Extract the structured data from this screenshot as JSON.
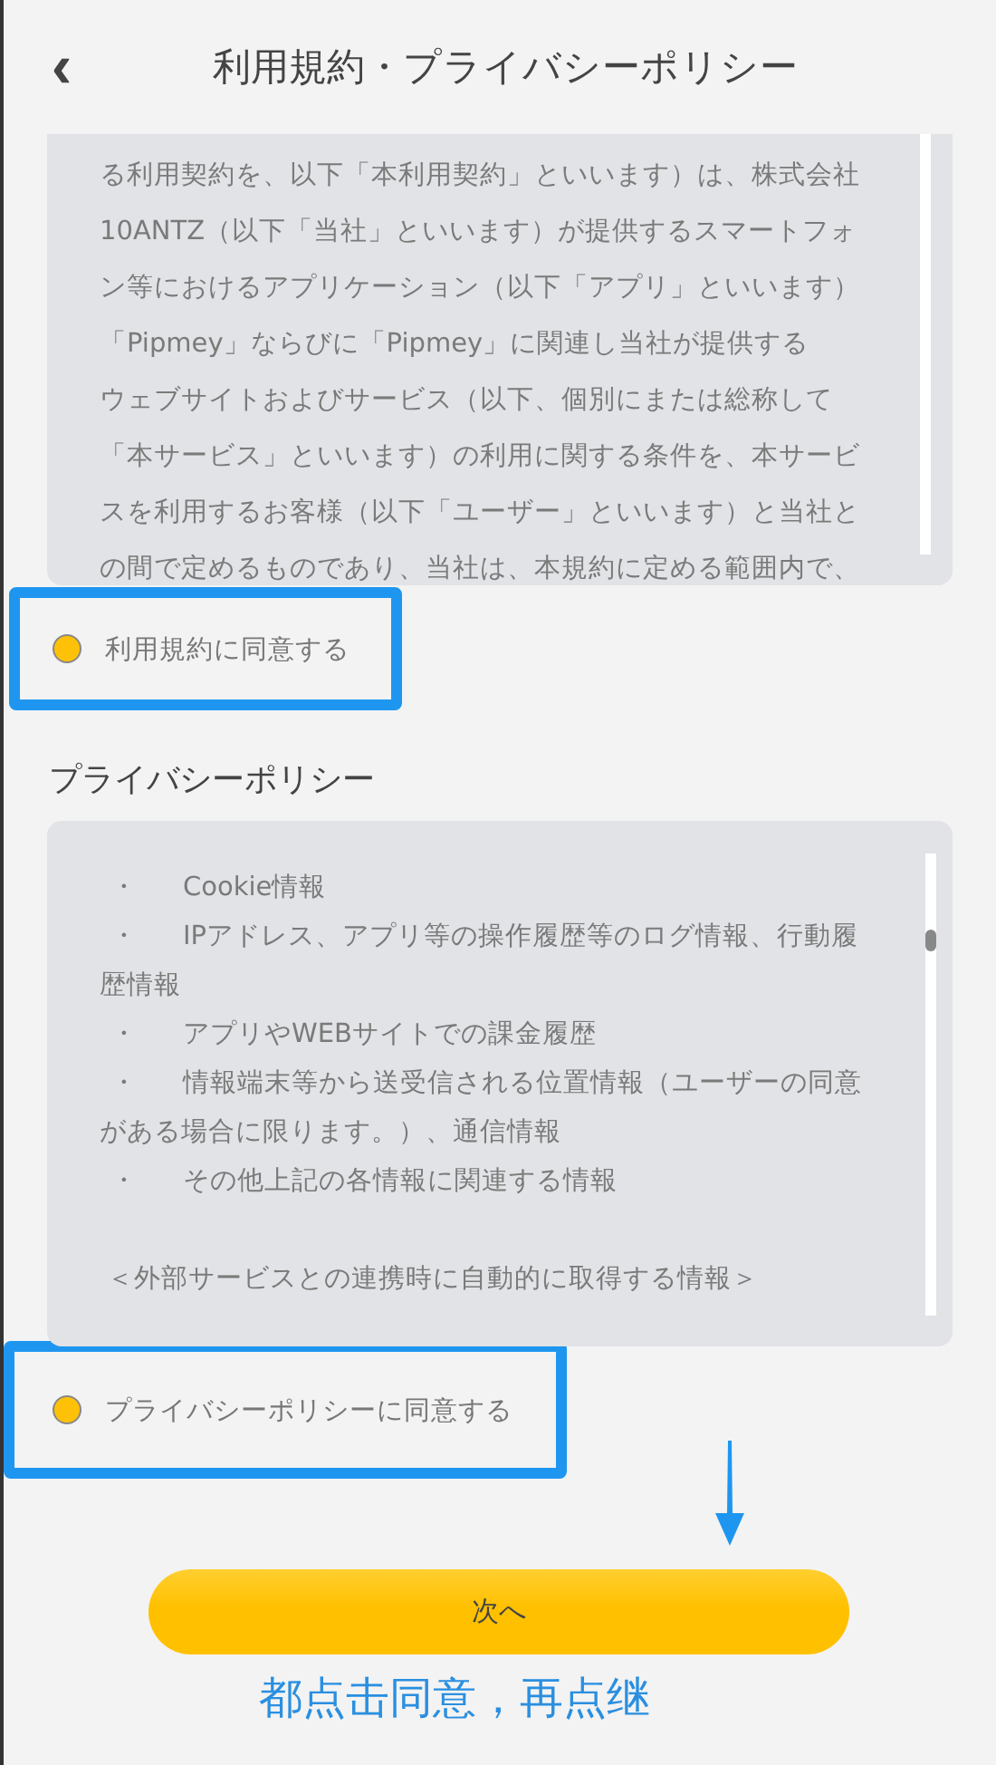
{
  "header": {
    "back": "‹",
    "title": "利用規約・プライバシーポリシー"
  },
  "terms": {
    "lines": [
      "る利用契約を、以下「本利用契約」といいます）は、株式会社",
      "10ANTZ（以下「当社」といいます）が提供するスマートフォ",
      "ン等におけるアプリケーション（以下「アプリ」といいます）",
      "「Pipmey」ならびに「Pipmey」に関連し当社が提供する",
      "ウェブサイトおよびサービス（以下、個別にまたは総称して",
      "「本サービス」といいます）の利用に関する条件を、本サービ",
      "スを利用するお客様（以下「ユーザー」といいます）と当社と",
      "の間で定めるものであり、当社は、本規約に定める範囲内で、"
    ]
  },
  "terms_agreement": {
    "label": "利用規約に同意する",
    "checked": true,
    "highlighted": true
  },
  "privacy": {
    "heading": "プライバシーポリシー",
    "items": [
      {
        "kind": "bullet",
        "marker": "・",
        "text": "Cookie情報"
      },
      {
        "kind": "bullet",
        "marker": "・",
        "text": "IPアドレス、アプリ等の操作履歴等のログ情報、行動履歴情報"
      },
      {
        "kind": "bullet",
        "marker": "・",
        "text": "アプリやWEBサイトでの課金履歴"
      },
      {
        "kind": "bullet",
        "marker": "・",
        "text": "情報端末等から送受信される位置情報（ユーザーの同意がある場合に限ります。）、通信情報"
      },
      {
        "kind": "bullet",
        "marker": "・",
        "text": "その他上記の各情報に関連する情報"
      },
      {
        "kind": "note",
        "text": "＜外部サービスとの連携時に自動的に取得する情報＞"
      }
    ]
  },
  "privacy_agreement": {
    "label": "プライバシーポリシーに同意する",
    "checked": true,
    "highlighted": true
  },
  "next_button": {
    "label": "次へ"
  },
  "annotation": {
    "text": "都点击同意，再点继"
  }
}
